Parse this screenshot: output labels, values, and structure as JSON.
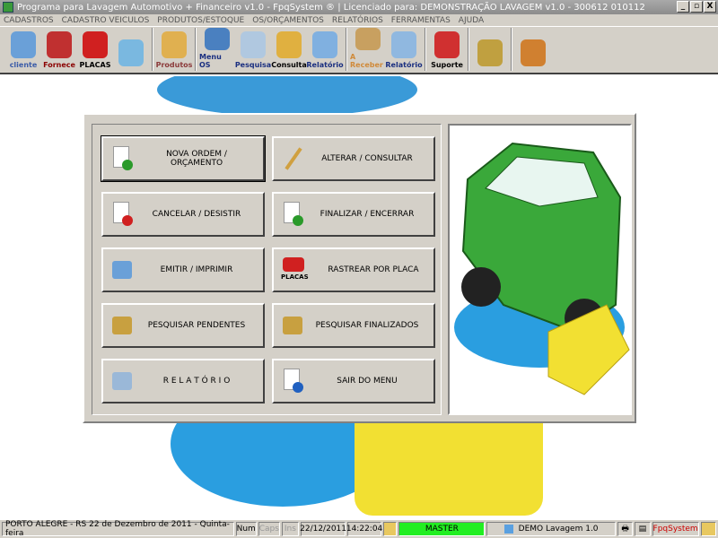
{
  "window": {
    "title": "Programa para Lavagem Automotivo + Financeiro v1.0 - FpqSystem ® | Licenciado para: DEMONSTRAÇÃO LAVAGEM v1.0 - 300612 010112",
    "minimize": "_",
    "restore": "▫",
    "close": "X"
  },
  "menu": [
    "CADASTROS",
    "CADASTRO VEICULOS",
    "PRODUTOS/ESTOQUE",
    "OS/ORÇAMENTOS",
    "RELATÓRIOS",
    "FERRAMENTAS",
    "AJUDA"
  ],
  "toolbar": [
    {
      "label": "cliente",
      "color": "#3b5ca8",
      "icon": "client-icon"
    },
    {
      "label": "Fornece",
      "color": "#8b0000",
      "icon": "supplier-icon"
    },
    {
      "label": "PLACAS",
      "color": "#000000",
      "icon": "license-plate-icon"
    },
    {
      "label": "",
      "color": "#000",
      "icon": "schedule-clock-icon"
    },
    {
      "label": "Produtos",
      "color": "#8b3a3a",
      "icon": "products-boxes-icon"
    },
    {
      "label": "Menu OS",
      "color": "#1a2f80",
      "icon": "service-order-icon"
    },
    {
      "label": "Pesquisa",
      "color": "#1a2f80",
      "icon": "search-icon"
    },
    {
      "label": "Consulta",
      "color": "#000000",
      "icon": "consult-drawer-icon"
    },
    {
      "label": "Relatório",
      "color": "#1a2f80",
      "icon": "report-icon"
    },
    {
      "label": "A Receber",
      "color": "#d08a3a",
      "icon": "receivable-icon"
    },
    {
      "label": "Relatório",
      "color": "#1a2f80",
      "icon": "financial-report-icon"
    },
    {
      "label": "Suporte",
      "color": "#000000",
      "icon": "support-icon"
    },
    {
      "label": "",
      "color": "#000",
      "icon": "coin-icon"
    },
    {
      "label": "",
      "color": "#000",
      "icon": "exit-door-icon"
    }
  ],
  "buttons": [
    {
      "label": "NOVA ORDEM / ORÇAMENTO",
      "icon": "new-document-icon"
    },
    {
      "label": "ALTERAR / CONSULTAR",
      "icon": "edit-pencil-icon"
    },
    {
      "label": "CANCELAR / DESISTIR",
      "icon": "cancel-document-icon"
    },
    {
      "label": "FINALIZAR / ENCERRAR",
      "icon": "finish-check-icon"
    },
    {
      "label": "EMITIR / IMPRIMIR",
      "icon": "print-person-icon"
    },
    {
      "label": "RASTREAR POR PLACA",
      "icon": "track-plate-icon",
      "sub": "PLACAS"
    },
    {
      "label": "PESQUISAR PENDENTES",
      "icon": "search-pending-icon"
    },
    {
      "label": "PESQUISAR FINALIZADOS",
      "icon": "search-finished-icon"
    },
    {
      "label": "R E L A T Ó R I O",
      "icon": "report-printer-icon"
    },
    {
      "label": "SAIR DO MENU",
      "icon": "exit-menu-icon"
    }
  ],
  "status": {
    "city": "PORTO ALEGRE - RS 22 de Dezembro de 2011 - Quinta-feira",
    "num": "Num",
    "caps": "Caps",
    "ins": "Ins",
    "date": "22/12/2011",
    "time": "14:22:04",
    "user": "MASTER",
    "version": "DEMO Lavagem 1.0",
    "brand": "FpqSystem",
    "user_color": "#22ee22",
    "brand_color": "#cc0000"
  }
}
